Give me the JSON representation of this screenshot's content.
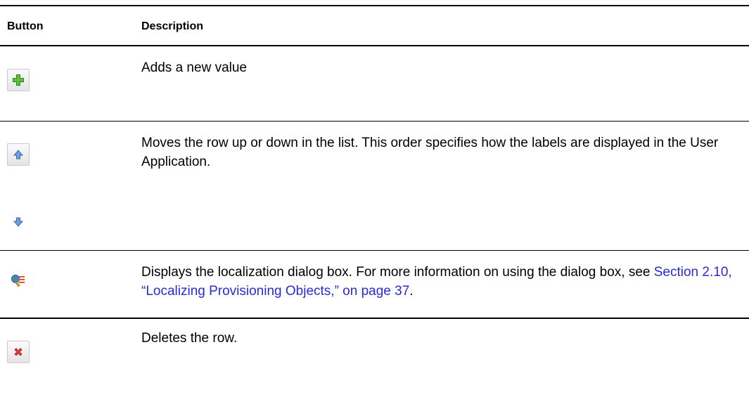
{
  "table": {
    "headers": {
      "button": "Button",
      "description": "Description"
    },
    "rows": [
      {
        "icon": "add-icon",
        "description": "Adds a new value"
      },
      {
        "icon": "move-up-icon",
        "description": "Moves the row up or down in the list. This order specifies how the labels are displayed in the User Application."
      },
      {
        "icon": "move-down-icon",
        "description": ""
      },
      {
        "icon": "localization-icon",
        "description_prefix": "Displays the localization dialog box. For more information on using the dialog box, see ",
        "link_text": "Section 2.10, “Localizing Provisioning Objects,” on page 37",
        "description_suffix": "."
      },
      {
        "icon": "delete-icon",
        "description": "Deletes the row."
      }
    ]
  },
  "colors": {
    "link": "#2a2ad8",
    "add_icon": "#4aa02c",
    "arrow_icon": "#5b8fd0",
    "delete_icon": "#d02a2a"
  }
}
